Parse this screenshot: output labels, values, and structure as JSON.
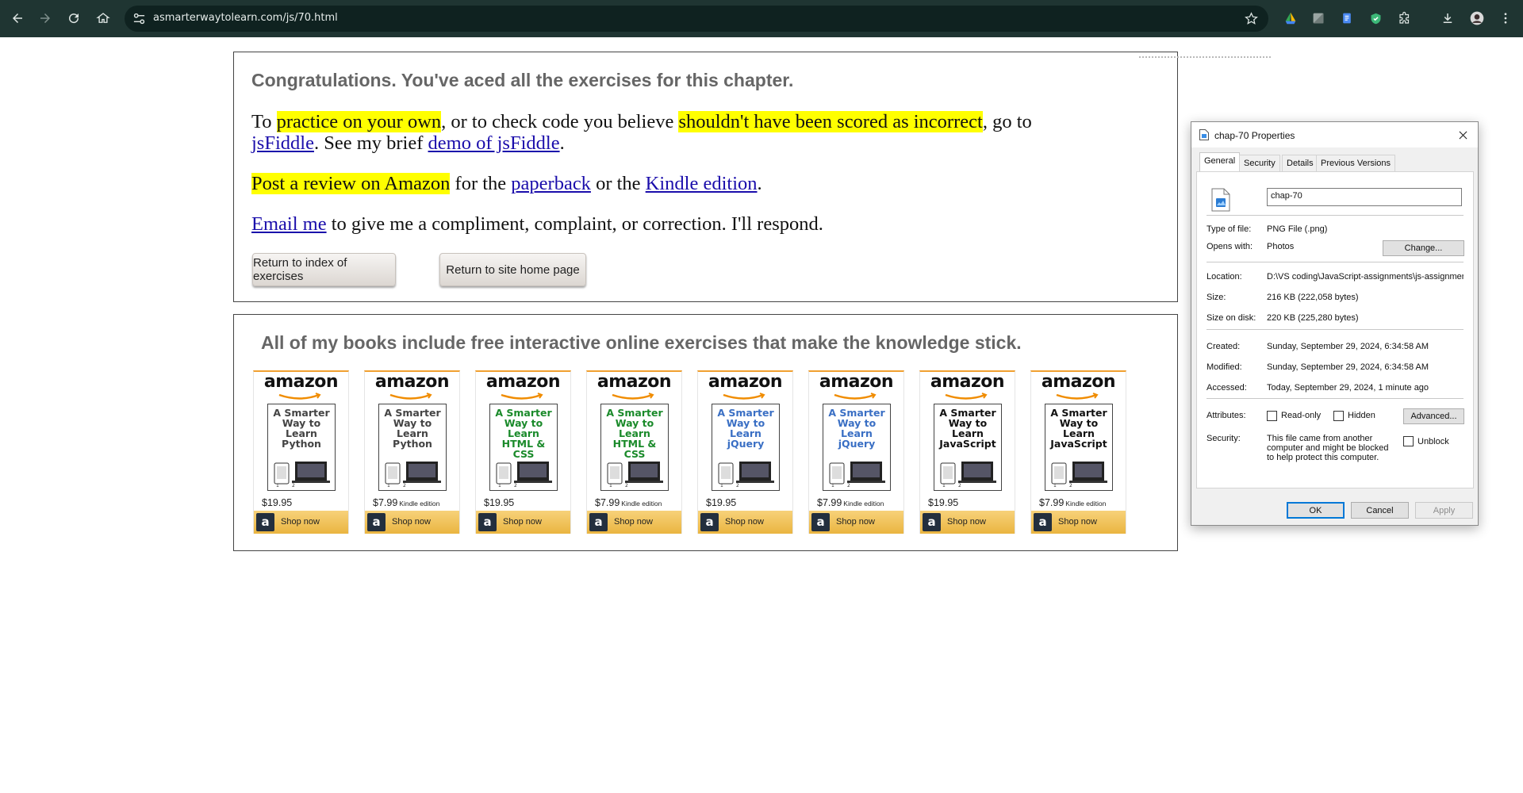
{
  "browser": {
    "url": "asmarterwaytolearn.com/js/70.html"
  },
  "congrats": {
    "title": "Congratulations. You've aced all the exercises for this chapter.",
    "p1": {
      "a": "To ",
      "hl1": "practice on your own",
      "b": ", or to check code you believe ",
      "hl2": "shouldn't have been scored as incorrect",
      "c": ", go to",
      "link1": "jsFiddle",
      "d": ". See my brief ",
      "link2": "demo of jsFiddle",
      "e": "."
    },
    "p2": {
      "hl": "Post a review on Amazon",
      "a": " for the ",
      "link1": "paperback",
      "b": " or the ",
      "link2": "Kindle edition",
      "c": "."
    },
    "p3": {
      "link": "Email me",
      "a": " to give me a compliment, complaint, or correction. I'll respond."
    },
    "buttons": {
      "index": "Return to index of exercises",
      "home": "Return to site home page"
    }
  },
  "books": {
    "title": "All of my books include free interactive online exercises that make the knowledge stick.",
    "logo_text": "amazon",
    "shop_label": "Shop now",
    "shop_icon_letter": "a",
    "kindle_note": "Kindle edition",
    "items": [
      {
        "cover": "A Smarter\nWay to\nLearn\nPython",
        "color": "#444444",
        "price": "$19.95",
        "kindle": false
      },
      {
        "cover": "A Smarter\nWay to\nLearn\nPython",
        "color": "#444444",
        "price": "$7.99",
        "kindle": true
      },
      {
        "cover": "A Smarter\nWay to\nLearn\nHTML & CSS",
        "color": "#1a8a2a",
        "price": "$19.95",
        "kindle": false
      },
      {
        "cover": "A Smarter\nWay to\nLearn\nHTML & CSS",
        "color": "#1a8a2a",
        "price": "$7.99",
        "kindle": true
      },
      {
        "cover": "A Smarter\nWay to\nLearn\njQuery",
        "color": "#3a6fc4",
        "price": "$19.95",
        "kindle": false
      },
      {
        "cover": "A Smarter\nWay to\nLearn\njQuery",
        "color": "#3a6fc4",
        "price": "$7.99",
        "kindle": true
      },
      {
        "cover": "A Smarter\nWay to\nLearn\nJavaScript",
        "color": "#111111",
        "price": "$19.95",
        "kindle": false
      },
      {
        "cover": "A Smarter\nWay to\nLearn\nJavaScript",
        "color": "#111111",
        "price": "$7.99",
        "kindle": true
      }
    ]
  },
  "dialog": {
    "title": "chap-70 Properties",
    "tabs": [
      "General",
      "Security",
      "Details",
      "Previous Versions"
    ],
    "file_name": "chap-70",
    "rows": {
      "type_label": "Type of file:",
      "type_value": "PNG File (.png)",
      "opens_label": "Opens with:",
      "opens_value": "Photos",
      "change_button": "Change...",
      "location_label": "Location:",
      "location_value": "D:\\VS coding\\JavaScript-assignments\\js-assignments",
      "size_label": "Size:",
      "size_value": "216 KB (222,058 bytes)",
      "disk_label": "Size on disk:",
      "disk_value": "220 KB (225,280 bytes)",
      "created_label": "Created:",
      "created_value": "Sunday, September 29, 2024, 6:34:58 AM",
      "modified_label": "Modified:",
      "modified_value": "Sunday, September 29, 2024, 6:34:58 AM",
      "accessed_label": "Accessed:",
      "accessed_value": "Today, September 29, 2024, 1 minute ago",
      "attributes_label": "Attributes:",
      "readonly_label": "Read-only",
      "hidden_label": "Hidden",
      "advanced_button": "Advanced...",
      "security_label": "Security:",
      "security_text": "This file came from another computer and might be blocked to help protect this computer.",
      "unblock_label": "Unblock"
    },
    "buttons": {
      "ok": "OK",
      "cancel": "Cancel",
      "apply": "Apply"
    }
  },
  "colors": {
    "highlight": "#ffff00",
    "link": "#1a0dab",
    "browser_chrome": "#1f3532",
    "dialog_focus": "#0078d7",
    "amazon_button": "#eab540"
  },
  "icons": [
    "back-icon",
    "forward-icon",
    "reload-icon",
    "home-icon",
    "site-settings-icon",
    "star-icon",
    "extension-icons",
    "download-icon",
    "profile-icon",
    "menu-icon",
    "close-icon",
    "image-file-icon"
  ]
}
